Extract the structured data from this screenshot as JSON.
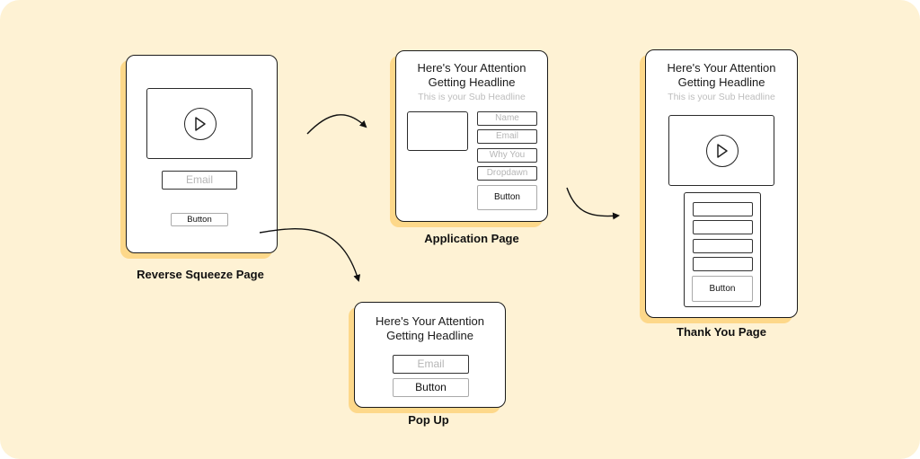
{
  "pages": {
    "reverse_squeeze": {
      "caption": "Reverse Squeeze Page",
      "email_placeholder": "Email",
      "button_label": "Button"
    },
    "application": {
      "caption": "Application Page",
      "headline_line1": "Here's Your Attention",
      "headline_line2": "Getting Headline",
      "sub_headline": "This is your Sub Headline",
      "fields": [
        "Name",
        "Email",
        "Why You",
        "Dropdawn"
      ],
      "button_label": "Button"
    },
    "thank_you": {
      "caption": "Thank You Page",
      "headline_line1": "Here's Your Attention",
      "headline_line2": "Getting Headline",
      "sub_headline": "This is your Sub Headline",
      "button_label": "Button"
    },
    "pop_up": {
      "caption": "Pop Up",
      "headline_line1": "Here's Your Attention",
      "headline_line2": "Getting Headline",
      "email_placeholder": "Email",
      "button_label": "Button"
    }
  },
  "colors": {
    "background": "#fef2d4",
    "shadow": "#fdd88a",
    "stroke": "#1a1a1a",
    "placeholder": "#b5b5b5"
  },
  "flow": [
    {
      "from": "Reverse Squeeze Page",
      "to": "Application Page"
    },
    {
      "from": "Reverse Squeeze Page",
      "to": "Pop Up"
    },
    {
      "from": "Application Page",
      "to": "Thank You Page"
    }
  ]
}
